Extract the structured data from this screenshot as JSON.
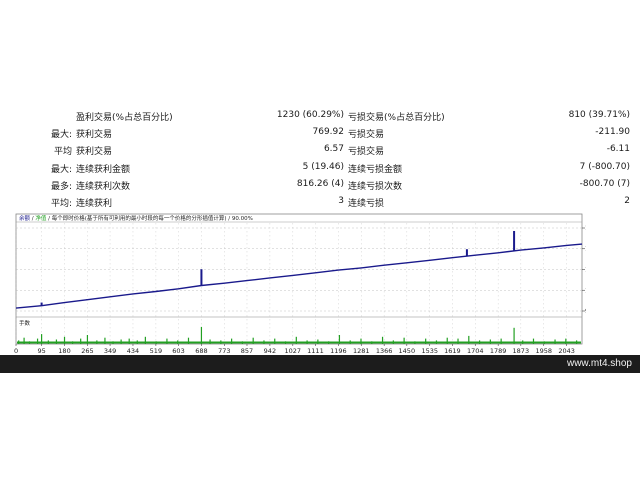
{
  "stats": [
    {
      "prefix": "",
      "label": "盈利交易(%占总百分比)",
      "value": "1230 (60.29%)",
      "label2": "亏损交易(%占总百分比)",
      "value2": "810 (39.71%)"
    },
    {
      "prefix": "最大:",
      "label": "获利交易",
      "value": "769.92",
      "label2": "亏损交易",
      "value2": "-211.90"
    },
    {
      "prefix": "平均",
      "label": "获利交易",
      "value": "6.57",
      "label2": "亏损交易",
      "value2": "-6.11"
    },
    {
      "prefix": "最大:",
      "label": "连续获利金额",
      "value": "5 (19.46)",
      "label2": "连续亏损金额",
      "value2": "7 (-800.70)"
    },
    {
      "prefix": "最多:",
      "label": "连续获利次数",
      "value": "816.26 (4)",
      "label2": "连续亏损次数",
      "value2": "-800.70 (7)"
    },
    {
      "prefix": "平均:",
      "label": "连续获利",
      "value": "3",
      "label2": "连续亏损",
      "value2": "2"
    }
  ],
  "chart": {
    "header": {
      "series1": "余额",
      "sep": " / ",
      "series2": "净值",
      "text": " / 每个即时价格(基于所有可利用的最小时段的每一个价格的分形插值计算) / 90.00%"
    },
    "colors": {
      "balance": "#1a1a8c",
      "volume": "#22a022",
      "grid": "#b4b4b4"
    }
  },
  "chart_data": [
    {
      "type": "line",
      "x": [
        0,
        60,
        95,
        180,
        265,
        349,
        434,
        519,
        603,
        688,
        773,
        857,
        942,
        1027,
        1111,
        1196,
        1281,
        1366,
        1450,
        1535,
        1619,
        1704,
        1789,
        1873,
        1958,
        2043,
        2100
      ],
      "series": [
        {
          "name": "余额",
          "values": [
            9950,
            10020,
            10060,
            10200,
            10330,
            10460,
            10590,
            10700,
            10820,
            10970,
            11070,
            11190,
            11310,
            11420,
            11540,
            11660,
            11760,
            11880,
            11990,
            12100,
            12220,
            12330,
            12440,
            12560,
            12660,
            12770,
            12830
          ]
        }
      ],
      "spikes": [
        {
          "x": 95,
          "value": 10200
        },
        {
          "x": 265,
          "value": 10360
        },
        {
          "x": 688,
          "value": 11700
        },
        {
          "x": 1673,
          "value": 12600
        },
        {
          "x": 1848,
          "value": 13420
        }
      ],
      "xticks": [
        "0",
        "95",
        "180",
        "265",
        "349",
        "434",
        "519",
        "603",
        "688",
        "773",
        "857",
        "942",
        "1027",
        "1111",
        "1196",
        "1281",
        "1366",
        "1450",
        "1535",
        "1619",
        "1704",
        "1789",
        "1873",
        "1958",
        "2043"
      ],
      "yticks": [
        "13554",
        "12621",
        "11688",
        "10754",
        "9821"
      ],
      "ylim": [
        9821,
        13554
      ],
      "xlim": [
        0,
        2100
      ]
    },
    {
      "type": "bar",
      "title": "手数",
      "x": [
        10,
        30,
        50,
        80,
        95,
        120,
        150,
        180,
        210,
        240,
        265,
        300,
        330,
        360,
        390,
        420,
        450,
        480,
        520,
        560,
        600,
        640,
        688,
        720,
        760,
        800,
        840,
        880,
        920,
        960,
        1000,
        1040,
        1080,
        1120,
        1160,
        1200,
        1240,
        1280,
        1320,
        1360,
        1400,
        1440,
        1480,
        1520,
        1560,
        1600,
        1640,
        1680,
        1720,
        1760,
        1800,
        1848,
        1880,
        1920,
        1960,
        2000,
        2040,
        2080
      ],
      "values": [
        0.2,
        0.35,
        0.15,
        0.3,
        0.55,
        0.2,
        0.25,
        0.4,
        0.15,
        0.3,
        0.5,
        0.2,
        0.35,
        0.15,
        0.25,
        0.3,
        0.2,
        0.4,
        0.15,
        0.3,
        0.2,
        0.35,
        0.95,
        0.25,
        0.2,
        0.3,
        0.15,
        0.35,
        0.2,
        0.3,
        0.15,
        0.4,
        0.2,
        0.25,
        0.15,
        0.5,
        0.2,
        0.3,
        0.15,
        0.4,
        0.2,
        0.35,
        0.15,
        0.3,
        0.2,
        0.35,
        0.3,
        0.45,
        0.2,
        0.25,
        0.3,
        0.9,
        0.2,
        0.3,
        0.15,
        0.25,
        0.3,
        0.2
      ],
      "ylim": [
        0,
        1
      ]
    }
  ],
  "footer": {
    "text": "www.mt4.shop"
  }
}
